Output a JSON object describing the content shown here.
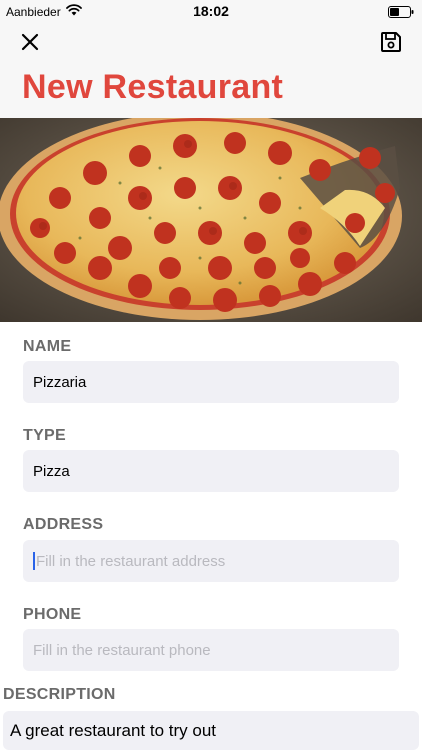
{
  "status": {
    "carrier": "Aanbieder",
    "time": "18:02"
  },
  "nav": {
    "title": "New Restaurant"
  },
  "form": {
    "name": {
      "label": "NAME",
      "value": "Pizzaria"
    },
    "type": {
      "label": "TYPE",
      "value": "Pizza"
    },
    "address": {
      "label": "ADDRESS",
      "placeholder": "Fill in the restaurant address"
    },
    "phone": {
      "label": "PHONE",
      "placeholder": "Fill in the restaurant phone"
    },
    "description": {
      "label": "DESCRIPTION",
      "value": "A great restaurant to try out"
    }
  },
  "colors": {
    "accent": "#e0473d",
    "field_bg": "#f0f0f5"
  },
  "icons": {
    "close": "close-icon",
    "save": "floppy-disk-icon",
    "wifi": "wifi-icon",
    "battery": "battery-icon"
  }
}
